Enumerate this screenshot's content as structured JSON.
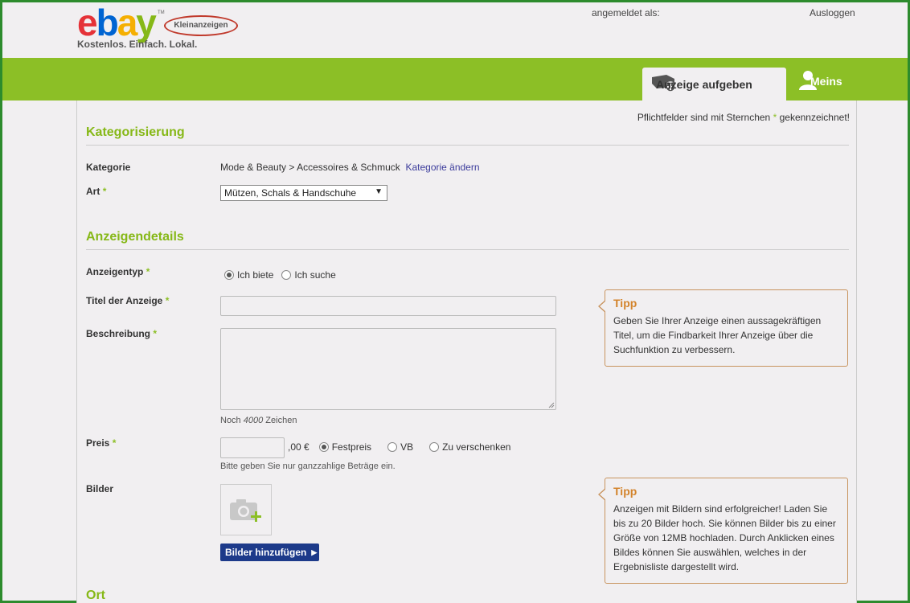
{
  "header": {
    "logo": "ebay",
    "logo_badge": "Kleinanzeigen",
    "tagline": "Kostenlos. Einfach. Lokal.",
    "login_label": "angemeldet als:",
    "logout": "Ausloggen"
  },
  "nav": {
    "post_ad": "Anzeige aufgeben",
    "meins": "Meins"
  },
  "form": {
    "required_note_pre": "Pflichtfelder sind mit Sternchen",
    "required_note_star": "*",
    "required_note_post": "gekennzeichnet!",
    "star": "*",
    "section_category": "Kategorisierung",
    "label_category": "Kategorie",
    "category_path": "Mode & Beauty > Accessoires & Schmuck",
    "change_category": "Kategorie ändern",
    "label_type": "Art",
    "type_selected": "Mützen, Schals & Handschuhe",
    "section_details": "Anzeigendetails",
    "label_adtype": "Anzeigentyp",
    "adtype_offer": "Ich biete",
    "adtype_search": "Ich suche",
    "label_title": "Titel der Anzeige",
    "label_description": "Beschreibung",
    "chars_pre": "Noch",
    "chars_count": "4000",
    "chars_post": "Zeichen",
    "label_price": "Preis",
    "price_suffix": ",00 €",
    "price_fixed": "Festpreis",
    "price_vb": "VB",
    "price_free": "Zu verschenken",
    "price_hint": "Bitte geben Sie nur ganzzahlige Beträge ein.",
    "label_images": "Bilder",
    "add_images": "Bilder hinzufügen",
    "section_location": "Ort"
  },
  "tips": [
    {
      "title": "Tipp",
      "text": "Geben Sie Ihrer Anzeige einen aussagekräftigen Titel, um die Findbarkeit Ihrer Anzeige über die Suchfunktion zu verbessern."
    },
    {
      "title": "Tipp",
      "text": "Anzeigen mit Bildern sind erfolgreicher! Laden Sie bis zu 20 Bilder hoch. Sie können Bilder bis zu einer Größe von 12MB hochladen. Durch Anklicken eines Bildes können Sie auswählen, welches in der Ergebnisliste dargestellt wird."
    }
  ],
  "colors": {
    "green": "#8cbf26",
    "title_green": "#86b817",
    "tip_orange": "#d3832b",
    "button_blue": "#1d3a8a"
  }
}
